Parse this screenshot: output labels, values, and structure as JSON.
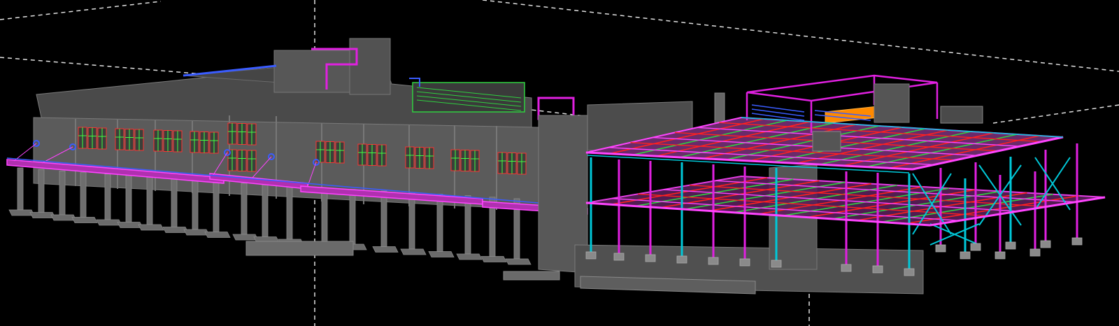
{
  "viewport": {
    "background": "#000000",
    "view_mode": "3d-perspective"
  },
  "colors": {
    "concrete_face": "#5b5b5b",
    "concrete_roof": "#4a4a4a",
    "concrete_dark": "#3c3c3c",
    "concrete_edge": "#7a7a7a",
    "steel_magenta": "#e020e0",
    "steel_pink": "#ff44ff",
    "steel_cyan": "#00c8d8",
    "duct_blue": "#3a5cff",
    "pipe_red": "#ff2020",
    "pipe_green": "#30d040",
    "equipment_orange": "#ff8a00",
    "window_glass": "#3a3f3a",
    "window_mullion_green": "#40ff40",
    "window_mullion_red": "#ff3030",
    "section_line": "#e0e0e0"
  },
  "legend_icons": [
    "building-model-icon",
    "section-plane-icon",
    "steel-frame-icon"
  ]
}
